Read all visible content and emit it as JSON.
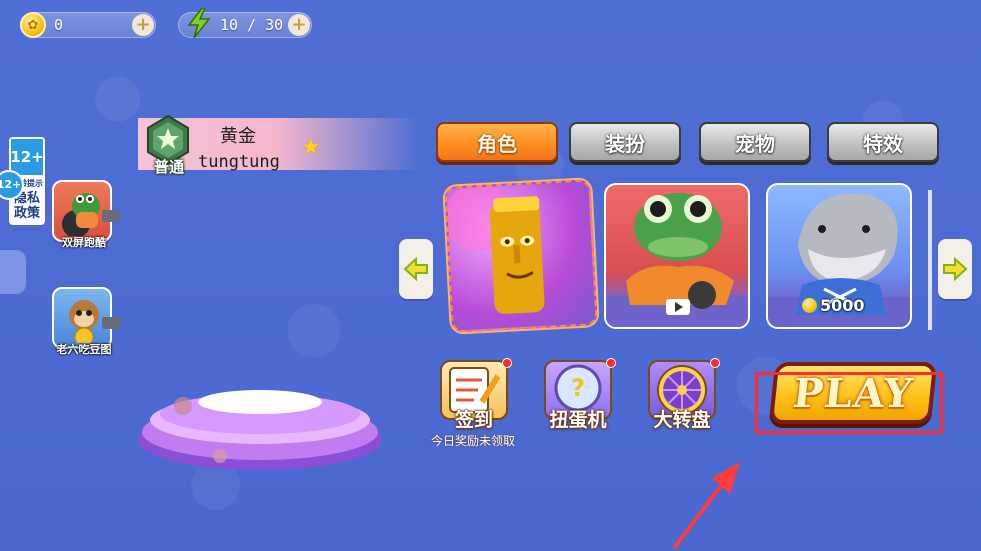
{
  "hud": {
    "coins": "0",
    "energy": "10 / 30",
    "add_label": "+"
  },
  "left_panel": {
    "age_rating": "12+",
    "age_notice": "适龄提示",
    "privacy": "隐私政策",
    "games": [
      {
        "label": "双屏跑酷"
      },
      {
        "label": "老六吃豆图"
      }
    ]
  },
  "player": {
    "rank_label": "普通",
    "tier": "黄金",
    "name": "tungtung"
  },
  "tabs": [
    {
      "label": "角色",
      "active": true
    },
    {
      "label": "装扮",
      "active": false
    },
    {
      "label": "宠物",
      "active": false
    },
    {
      "label": "特效",
      "active": false
    }
  ],
  "characters": [
    {
      "name": "golden-idol",
      "selected": true
    },
    {
      "name": "crocodile",
      "unlock": "video"
    },
    {
      "name": "shark",
      "price": "5000"
    }
  ],
  "features": [
    {
      "label": "签到",
      "sub": "今日奖励未领取"
    },
    {
      "label": "扭蛋机"
    },
    {
      "label": "大转盘"
    }
  ],
  "play": {
    "label": "PLAY"
  },
  "colors": {
    "background": "#4d6bd2",
    "tab_active": "#ff8c1f",
    "play_highlight": "#ff2d2d"
  }
}
